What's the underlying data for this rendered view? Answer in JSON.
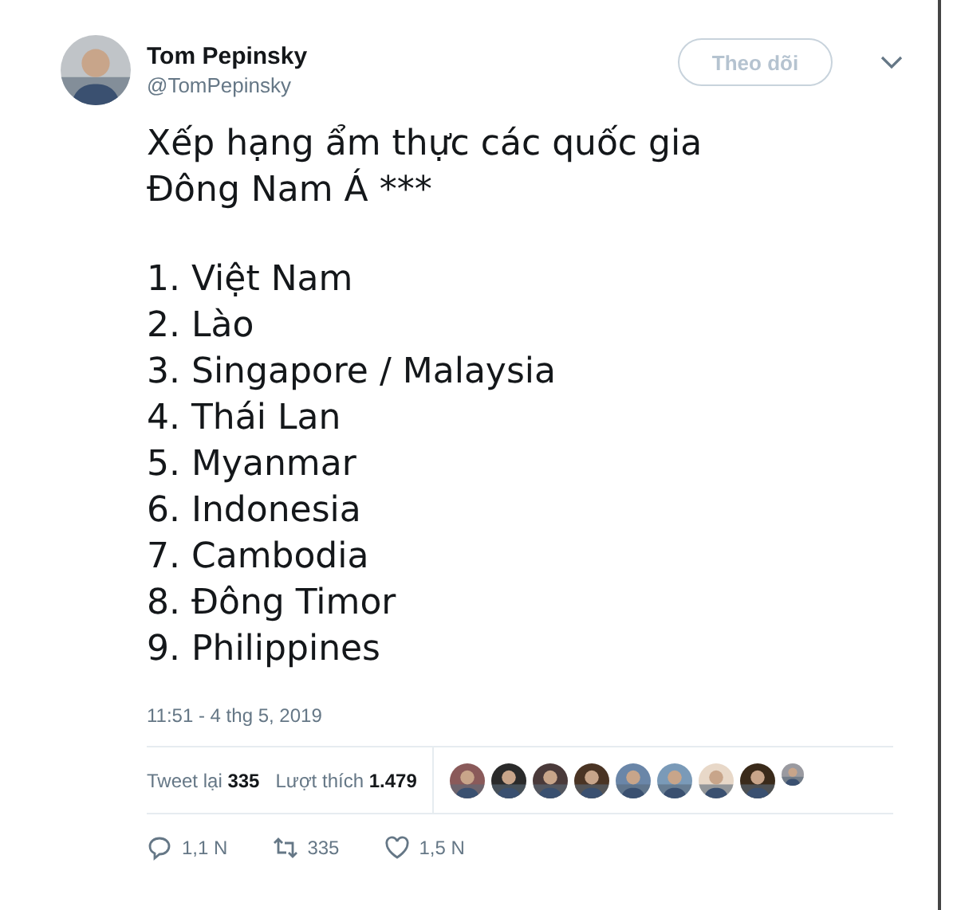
{
  "author": {
    "name": "Tom Pepinsky",
    "handle": "@TomPepinsky"
  },
  "follow_button": {
    "label": "Theo dõi"
  },
  "tweet": {
    "heading_lines": [
      "Xếp hạng ẩm thực các quốc gia",
      "Đông Nam Á ***"
    ],
    "list": [
      "1. Việt Nam",
      "2. Lào",
      "3. Singapore / Malaysia",
      "4. Thái Lan",
      "5. Myanmar",
      "6. Indonesia",
      "7. Cambodia",
      "8. Đông Timor",
      "9. Philippines"
    ]
  },
  "timestamp": "11:51 - 4 thg 5, 2019",
  "stats": [
    {
      "label": "Tweet lại",
      "count": "335"
    },
    {
      "label": "Lượt thích",
      "count": "1.479"
    }
  ],
  "actions": [
    {
      "kind": "reply",
      "count": "1,1 N"
    },
    {
      "kind": "retweet",
      "count": "335"
    },
    {
      "kind": "like",
      "count": "1,5 N"
    }
  ]
}
